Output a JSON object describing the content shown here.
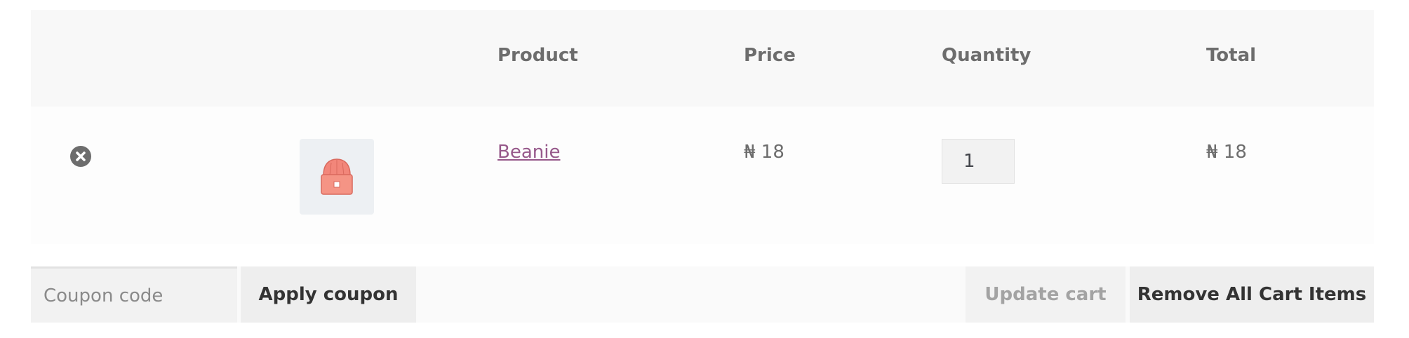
{
  "table": {
    "headers": {
      "remove": "",
      "thumbnail": "",
      "product": "Product",
      "price": "Price",
      "quantity": "Quantity",
      "total": "Total"
    },
    "items": [
      {
        "name": "Beanie",
        "price": "₦ 18",
        "quantity": "1",
        "total": "₦ 18",
        "thumbnail_icon": "beanie-hat-icon",
        "remove_icon": "remove-circle-x-icon"
      }
    ]
  },
  "actions": {
    "coupon_placeholder": "Coupon code",
    "apply_coupon_label": "Apply coupon",
    "update_cart_label": "Update cart",
    "remove_all_label": "Remove All Cart Items"
  },
  "colors": {
    "link": "#96588a",
    "header_bg": "#f8f8f8",
    "button_bg": "#eeeeee",
    "disabled_text": "#a3a3a3",
    "remove_icon": "#6d6d6d",
    "beanie": "#f2867a"
  }
}
